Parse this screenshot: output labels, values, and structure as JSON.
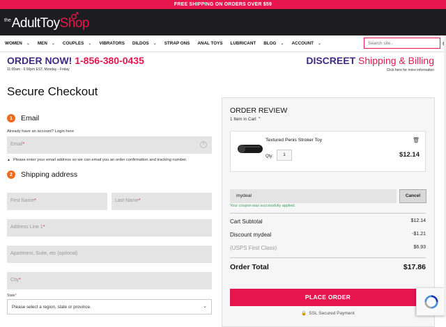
{
  "promo": "FREE SHIPPING ON ORDERS OVER $59",
  "logo": {
    "the": "the",
    "adult": "Adult",
    "toy": "Toy",
    "shop": "Shop"
  },
  "nav": [
    {
      "label": "WOMEN",
      "chevron": true
    },
    {
      "label": "MEN",
      "chevron": true
    },
    {
      "label": "COUPLES",
      "chevron": true
    },
    {
      "label": "VIBRATORS",
      "chevron": false
    },
    {
      "label": "DILDOS",
      "chevron": true
    },
    {
      "label": "STRAP ONS",
      "chevron": false
    },
    {
      "label": "ANAL TOYS",
      "chevron": false
    },
    {
      "label": "LUBRICANT",
      "chevron": false
    },
    {
      "label": "BLOG",
      "chevron": true
    },
    {
      "label": "ACCOUNT",
      "chevron": true
    }
  ],
  "search": {
    "placeholder": "Search site.."
  },
  "order_bar": {
    "order_now": "ORDER NOW!",
    "phone": "1-856-380-0435",
    "hours": "11:00am - 6:00pm EST, Monday - Friday",
    "discreet": "DISCREET",
    "discreet_rest": "Shipping & Billing",
    "more_info": "Click here for more information"
  },
  "checkout": {
    "title": "Secure Checkout",
    "email_step": {
      "num": "1",
      "title": "Email"
    },
    "account_text": "Already have an account? Login here",
    "email_placeholder": "Email",
    "email_note": "Please enter your email address so we can email you an order confirmation and tracking number.",
    "shipping_step": {
      "num": "2",
      "title": "Shipping address"
    },
    "first_name": "First Name",
    "last_name": "Last Name",
    "address1": "Address Line 1",
    "address2": "Apartment, Suite, etc (optional)",
    "city": "City",
    "state_label": "State",
    "state_value": "Please select a region, state or province."
  },
  "review": {
    "title": "ORDER REVIEW",
    "in_cart": "1 Item in Cart",
    "item": {
      "name": "Textured Penis Stroker Toy",
      "qty_label": "Qty:",
      "qty": "1",
      "price": "$12.14"
    },
    "coupon_code": "mydeal",
    "cancel": "Cancel",
    "applied": "Your coupon was successfully applied.",
    "subtotal_label": "Cart Subtotal",
    "subtotal": "$12.14",
    "discount_label": "Discount mydeal",
    "discount": "-$1.21",
    "shipping_label": "(USPS First Class)",
    "shipping": "$6.93",
    "total_label": "Order Total",
    "total": "$17.86",
    "place_order": "PLACE ORDER",
    "ssl": "SSL Secured Payment"
  },
  "colors": {
    "brand_pink": "#e6154e",
    "brand_purple": "#3d2b82",
    "step_orange": "#f06a1c",
    "success_green": "#3aa35b"
  }
}
